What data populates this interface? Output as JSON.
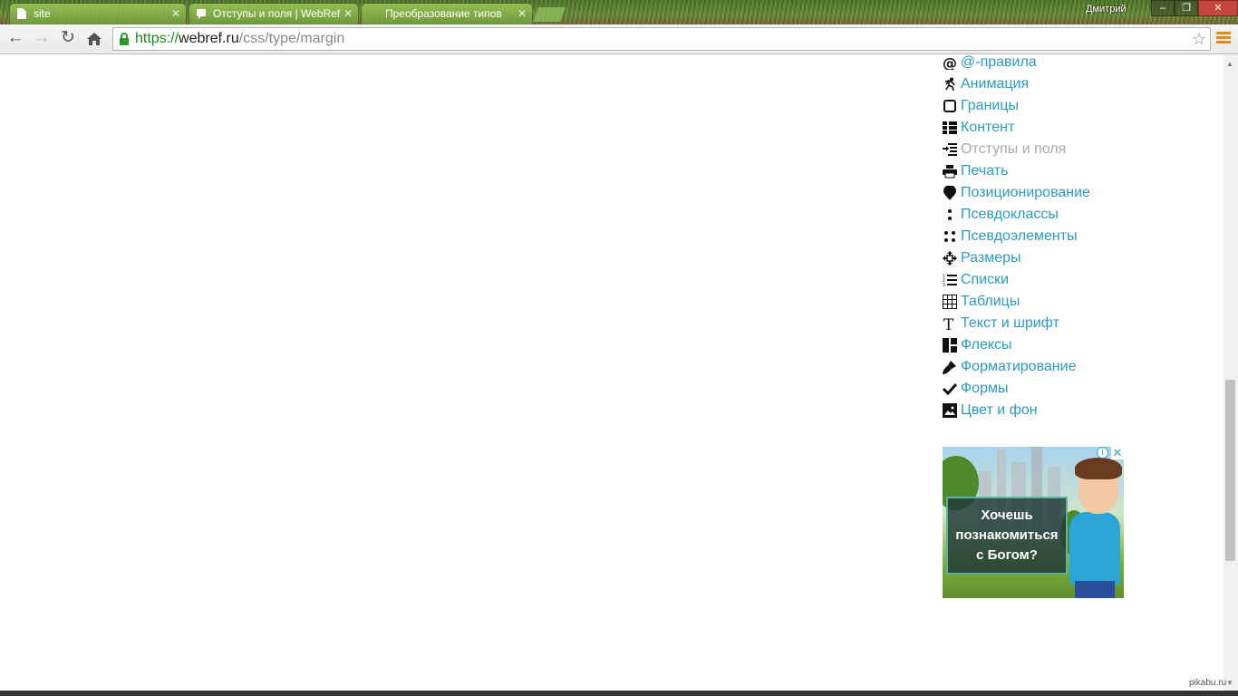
{
  "browser": {
    "tabs": [
      {
        "title": "site",
        "active": false
      },
      {
        "title": "Отступы и поля | WebRef",
        "active": true
      },
      {
        "title": "Преобразование типов",
        "active": false
      }
    ],
    "user_name": "Дмитрий",
    "url": {
      "scheme": "https://",
      "host": "webref.ru",
      "path": "/css/type/margin"
    },
    "window_buttons": {
      "minimize": "–",
      "maximize": "❐",
      "close": "✕"
    }
  },
  "sidebar": {
    "items": [
      {
        "label": "@-правила",
        "icon": "at-icon",
        "current": false
      },
      {
        "label": "Анимация",
        "icon": "running-man-icon",
        "current": false
      },
      {
        "label": "Границы",
        "icon": "square-border-icon",
        "current": false
      },
      {
        "label": "Контент",
        "icon": "content-list-icon",
        "current": false
      },
      {
        "label": "Отступы и поля",
        "icon": "indent-icon",
        "current": true
      },
      {
        "label": "Печать",
        "icon": "printer-icon",
        "current": false
      },
      {
        "label": "Позиционирование",
        "icon": "map-pin-icon",
        "current": false
      },
      {
        "label": "Псевдоклассы",
        "icon": "colon-icon",
        "current": false
      },
      {
        "label": "Псевдоэлементы",
        "icon": "double-colon-icon",
        "current": false
      },
      {
        "label": "Размеры",
        "icon": "resize-arrows-icon",
        "current": false
      },
      {
        "label": "Списки",
        "icon": "numbered-list-icon",
        "current": false
      },
      {
        "label": "Таблицы",
        "icon": "table-grid-icon",
        "current": false
      },
      {
        "label": "Текст и шрифт",
        "icon": "text-t-icon",
        "current": false
      },
      {
        "label": "Флексы",
        "icon": "flex-layout-icon",
        "current": false
      },
      {
        "label": "Форматирование",
        "icon": "paintbrush-icon",
        "current": false
      },
      {
        "label": "Формы",
        "icon": "checkmark-icon",
        "current": false
      },
      {
        "label": "Цвет и фон",
        "icon": "image-icon",
        "current": false
      }
    ],
    "link_color": "#2a9bc3",
    "current_color": "#aaaaaa"
  },
  "ad": {
    "line1": "Хочешь",
    "line2": "познакомиться",
    "line3": "с Богом?",
    "info_symbol": "i",
    "close_symbol": "✕"
  },
  "watermark": "pikabu.ru"
}
